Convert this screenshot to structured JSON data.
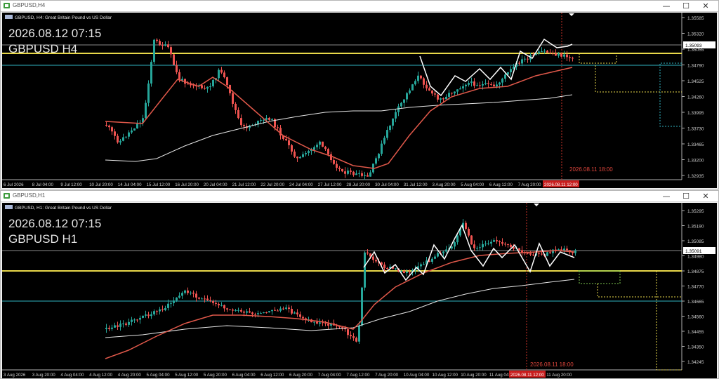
{
  "top": {
    "window_title": "GBPUSD,H4",
    "info_line": "GBPUSD, H4:  Great Britain Pound vs US Dollar",
    "overlay_time": "2026.08.12 07:15",
    "overlay_symbol": "GBPUSD H4",
    "bid_label": "1.35093",
    "vline_label": "2026.08.11 18:00",
    "xaxis_highlight": "2026.08.11 12:00",
    "price_labels": [
      "1.35585",
      "1.35320",
      "1.35055",
      "1.34790",
      "1.34525",
      "1.34260",
      "1.33995",
      "1.33730",
      "1.33465",
      "1.33200",
      "1.32935"
    ],
    "time_labels": [
      "6 Jul 2026",
      "8 Jul 04:00",
      "9 Jul 12:00",
      "10 Jul 20:00",
      "14 Jul 04:00",
      "15 Jul 12:00",
      "16 Jul 20:00",
      "20 Jul 04:00",
      "21 Jul 12:00",
      "22 Jul 20:00",
      "24 Jul 04:00",
      "27 Jul 12:00",
      "28 Jul 20:00",
      "30 Jul 04:00",
      "31 Jul 12:00",
      "3 Aug 20:00",
      "5 Aug 04:00",
      "6 Aug 12:00",
      "7 Aug 20:00"
    ]
  },
  "bottom": {
    "window_title": "GBPUSD,H1",
    "info_line": "GBPUSD, H1:  Great Britain Pound vs US Dollar",
    "overlay_time": "2026.08.12 07:15",
    "overlay_symbol": "GBPUSD H1",
    "bid_label": "1.35091",
    "vline_label": "2026.08.11 18:00",
    "xaxis_highlight": "2026.08.11 12:00",
    "price_labels": [
      "1.35295",
      "1.35190",
      "1.35085",
      "1.34980",
      "1.34875",
      "1.34770",
      "1.34665",
      "1.34560",
      "1.34455",
      "1.34350",
      "1.34245"
    ],
    "time_labels": [
      "3 Aug 2026",
      "3 Aug 20:00",
      "4 Aug 04:00",
      "4 Aug 12:00",
      "4 Aug 20:00",
      "5 Aug 04:00",
      "5 Aug 12:00",
      "5 Aug 20:00",
      "6 Aug 04:00",
      "6 Aug 12:00",
      "6 Aug 20:00",
      "7 Aug 04:00",
      "7 Aug 12:00",
      "7 Aug 20:00",
      "10 Aug 04:00",
      "10 Aug 12:00",
      "10 Aug 20:00",
      "11 Aug 04:00",
      "11 Aug 12:00",
      "11 Aug 20:00"
    ]
  },
  "controls": {
    "minimize": "—",
    "maximize": "☐",
    "close": "✕"
  },
  "colors": {
    "bull": "#26a69a",
    "bear": "#ef5350",
    "ma_fast": "#e0584a",
    "ma_slow": "#e6e6e6",
    "zigzag": "#ffffff",
    "yellow": "#e8d84a",
    "cyan": "#2fb3c2",
    "green": "#7ec850",
    "grid": "#888888",
    "vline": "#c83228"
  }
}
